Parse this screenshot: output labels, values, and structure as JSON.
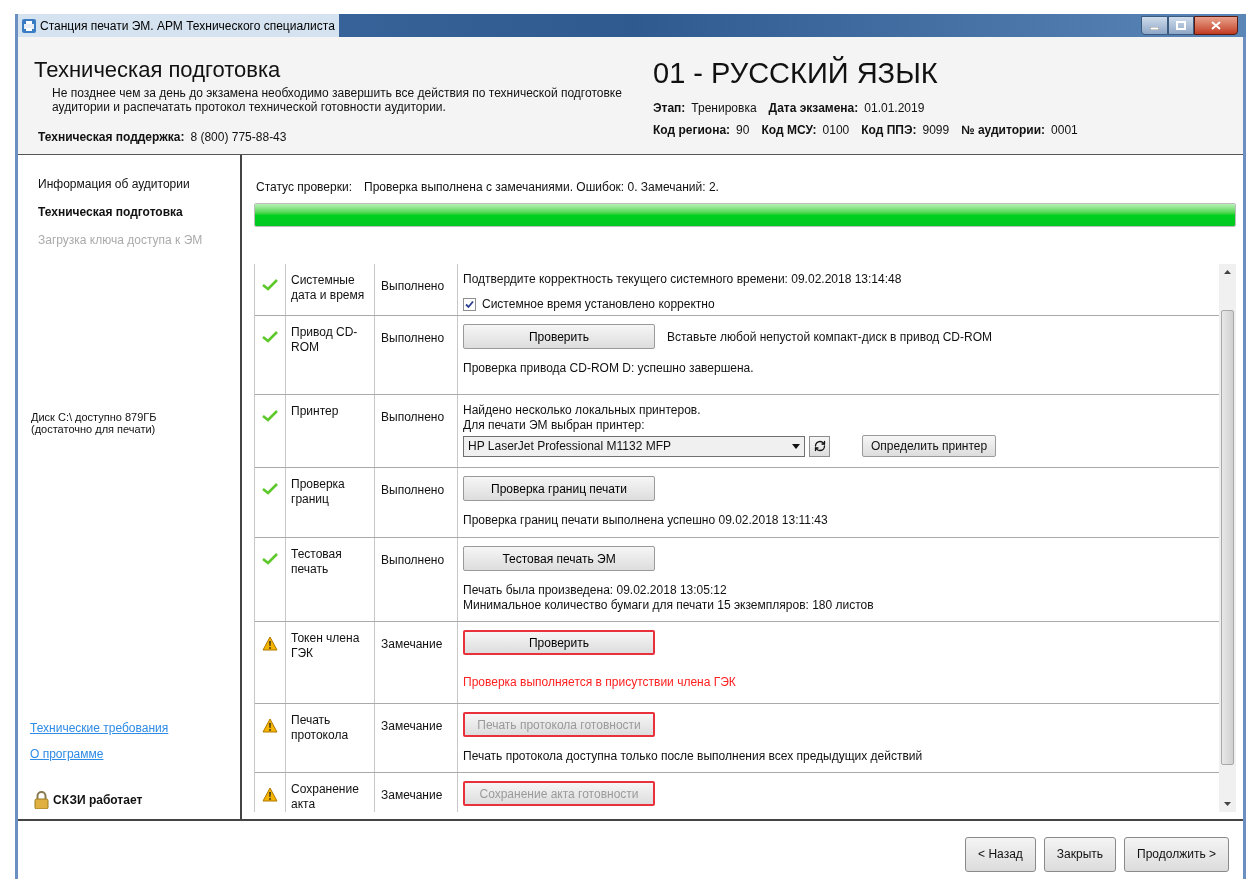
{
  "window": {
    "title": "Станция печати ЭМ. АРМ Технического специалиста"
  },
  "header": {
    "title": "Техническая подготовка",
    "description": "Не позднее чем за день до экзамена необходимо завершить все действия по технической подготовке аудитории и распечатать протокол технической готовности аудитории.",
    "support_label": "Техническая поддержка:",
    "support_phone": "8 (800) 775-88-43",
    "subject": "01 - РУССКИЙ ЯЗЫК",
    "info_lines": [
      [
        {
          "label": "Этап:",
          "value": "Тренировка"
        },
        {
          "label": "Дата экзамена:",
          "value": "01.01.2019"
        }
      ],
      [
        {
          "label": "Код региона:",
          "value": "90"
        },
        {
          "label": "Код МСУ:",
          "value": "0100"
        },
        {
          "label": "Код ППЭ:",
          "value": "9099"
        },
        {
          "label": "№ аудитории:",
          "value": "0001"
        }
      ]
    ]
  },
  "sidebar": {
    "items": [
      {
        "label": "Информация об аудитории",
        "selected": false,
        "disabled": false
      },
      {
        "label": "Техническая подготовка",
        "selected": true,
        "disabled": false
      },
      {
        "label": "Загрузка ключа доступа к ЭМ",
        "selected": false,
        "disabled": true
      }
    ],
    "disk_info": [
      "Диск C:\\ доступно 879ГБ",
      "(достаточно для печати)"
    ],
    "links": [
      "Технические требования",
      "О программе"
    ],
    "skzi_status": "СКЗИ работает"
  },
  "status": {
    "label": "Статус проверки:",
    "text": "Проверка выполнена с замечаниями. Ошибок: 0. Замечаний: 2.",
    "level": 1
  },
  "checks": [
    {
      "kind": "ok",
      "name": "Системные дата и время",
      "result": "Выполнено",
      "lines": [
        {
          "kind": "text",
          "text": "Подтвердите корректность текущего системного времени: 09.02.2018 13:14:48"
        },
        {
          "kind": "checkbox",
          "label": "Системное время установлено корректно",
          "checked": true
        }
      ]
    },
    {
      "kind": "ok",
      "name": "Привод CD-ROM",
      "result": "Выполнено",
      "lines": [
        {
          "kind": "button",
          "label": "Проверить",
          "hint": "Вставьте любой непустой компакт-диск в привод CD-ROM",
          "highlighted": false,
          "disabled": false
        },
        {
          "kind": "text",
          "text": "Проверка привода CD-ROM D: успешно завершена."
        }
      ]
    },
    {
      "kind": "ok",
      "name": "Принтер",
      "result": "Выполнено",
      "lines": [
        {
          "kind": "text",
          "text": "Найдено несколько локальных принтеров."
        },
        {
          "kind": "text",
          "text": "Для печати ЭМ выбран принтер:"
        },
        {
          "kind": "select",
          "value": "HP LaserJet Professional M1132 MFP",
          "button": "Определить принтер"
        }
      ]
    },
    {
      "kind": "ok",
      "name": "Проверка границ",
      "result": "Выполнено",
      "lines": [
        {
          "kind": "button",
          "label": "Проверка границ печати",
          "highlighted": false,
          "disabled": false
        },
        {
          "kind": "text",
          "text": "Проверка границ печати выполнена успешно 09.02.2018 13:11:43"
        }
      ]
    },
    {
      "kind": "ok",
      "name": "Тестовая печать",
      "result": "Выполнено",
      "lines": [
        {
          "kind": "button",
          "label": "Тестовая печать ЭМ",
          "highlighted": false,
          "disabled": false
        },
        {
          "kind": "text",
          "text": "Печать была произведена: 09.02.2018 13:05:12"
        },
        {
          "kind": "text",
          "text": "Минимальное количество бумаги для печати 15 экземпляров: 180 листов"
        }
      ]
    },
    {
      "kind": "warning",
      "name": "Токен члена ГЭК",
      "result": "Замечание",
      "lines": [
        {
          "kind": "button",
          "label": "Проверить",
          "highlighted": true,
          "disabled": false
        },
        {
          "kind": "error",
          "text": "Проверка выполняется в присутствии члена ГЭК"
        }
      ]
    },
    {
      "kind": "warning",
      "name": "Печать протокола",
      "result": "Замечание",
      "lines": [
        {
          "kind": "button",
          "label": "Печать протокола готовности",
          "highlighted": true,
          "disabled": true
        },
        {
          "kind": "text",
          "text": "Печать протокола доступна только после выполнения всех предыдущих действий"
        }
      ]
    },
    {
      "kind": "warning",
      "name": "Сохранение акта",
      "result": "Замечание",
      "lines": [
        {
          "kind": "button",
          "label": "Сохранение акта готовности",
          "highlighted": true,
          "disabled": true
        }
      ]
    }
  ],
  "footer_buttons": [
    "< Назад",
    "Закрыть",
    "Продолжить >"
  ]
}
